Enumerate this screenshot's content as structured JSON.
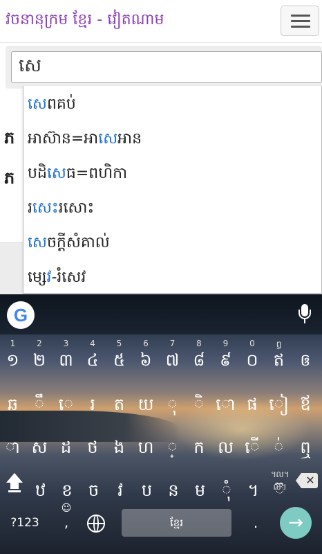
{
  "header": {
    "title": "វចនានុក្រម ខ្មែរ - វៀតណាម"
  },
  "search": {
    "value": "សេ"
  },
  "background": {
    "row_chars": [
      "ភ",
      "ភ"
    ]
  },
  "suggestions": [
    {
      "prefix": "",
      "match": "សេ",
      "suffix": "ពគប់"
    },
    {
      "prefix": "អាស៊ាន=អា",
      "match": "សេ",
      "suffix": "អាន"
    },
    {
      "prefix": "បដិ",
      "match": "សេ",
      "suffix": "ធ=ពហិកា"
    },
    {
      "prefix": "រ",
      "match": "សេ",
      "suffix": "ះរសោះ"
    },
    {
      "prefix": "",
      "match": "សេ",
      "suffix": "ចក្ដីសំគាល់"
    },
    {
      "prefix": "ម្",
      "match": "សេវ",
      "suffix": "-រំសេវ"
    }
  ],
  "keyboard": {
    "google_logo": "G",
    "mic_icon": "mic-icon",
    "row1": [
      {
        "hint": "1",
        "ch": "១"
      },
      {
        "hint": "2",
        "ch": "២"
      },
      {
        "hint": "3",
        "ch": "៣"
      },
      {
        "hint": "4",
        "ch": "៤"
      },
      {
        "hint": "5",
        "ch": "៥"
      },
      {
        "hint": "6",
        "ch": "៦"
      },
      {
        "hint": "7",
        "ch": "៧"
      },
      {
        "hint": "8",
        "ch": "៨"
      },
      {
        "hint": "9",
        "ch": "៩"
      },
      {
        "hint": "0",
        "ch": "០"
      },
      {
        "hint": "ឰ",
        "ch": "ឥ"
      },
      {
        "hint": "",
        "ch": "ឲ"
      }
    ],
    "row2": [
      {
        "hint": "",
        "ch": "ឆ"
      },
      {
        "hint": "",
        "ch": "ឹ"
      },
      {
        "hint": "",
        "ch": "េ"
      },
      {
        "hint": "",
        "ch": "រ"
      },
      {
        "hint": "",
        "ch": "ត"
      },
      {
        "hint": "",
        "ch": "យ"
      },
      {
        "hint": "",
        "ch": "ុ"
      },
      {
        "hint": "",
        "ch": "ិ"
      },
      {
        "hint": "",
        "ch": "ោ"
      },
      {
        "hint": "",
        "ch": "ផ"
      },
      {
        "hint": "",
        "ch": "ៀ"
      },
      {
        "hint": "",
        "ch": "ឪ"
      }
    ],
    "row3": [
      {
        "hint": "",
        "ch": "ា"
      },
      {
        "hint": "",
        "ch": "ស"
      },
      {
        "hint": "",
        "ch": "ដ"
      },
      {
        "hint": "",
        "ch": "ថ"
      },
      {
        "hint": "",
        "ch": "ង"
      },
      {
        "hint": "",
        "ch": "ហ"
      },
      {
        "hint": "",
        "ch": "្"
      },
      {
        "hint": "",
        "ch": "ក"
      },
      {
        "hint": "",
        "ch": "ល"
      },
      {
        "hint": "",
        "ch": "ើ"
      },
      {
        "hint": "",
        "ch": "់"
      },
      {
        "hint": "",
        "ch": "ឮ"
      }
    ],
    "row4": [
      {
        "hint": "",
        "ch": "ឋ"
      },
      {
        "hint": "",
        "ch": "ខ"
      },
      {
        "hint": "",
        "ch": "ច"
      },
      {
        "hint": "",
        "ch": "វ"
      },
      {
        "hint": "",
        "ch": "ប"
      },
      {
        "hint": "",
        "ch": "ន"
      },
      {
        "hint": "",
        "ch": "ម"
      },
      {
        "hint": "",
        "ch": "ុំ"
      },
      {
        "hint": "",
        "ch": "។"
      },
      {
        "hint": "៘ល។",
        "ch": "៊"
      }
    ],
    "symbols_label": "?123",
    "comma_label": ",",
    "space_label": "ខ្មែរ",
    "period_label": ".",
    "enter_label": "→",
    "emoji_hint": "☺"
  }
}
